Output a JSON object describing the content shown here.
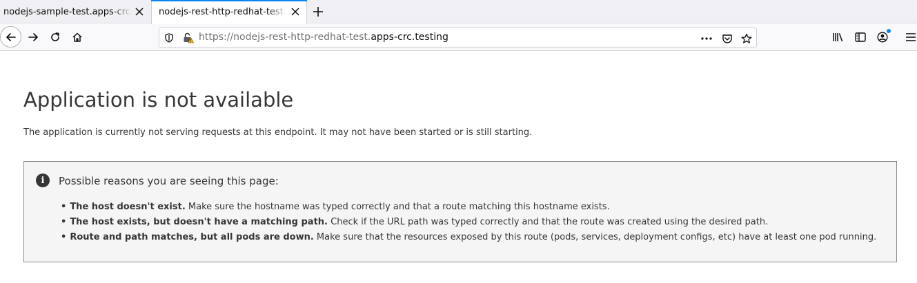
{
  "browser": {
    "tabs": [
      {
        "title": "nodejs-sample-test.apps-crc.testing",
        "active": false
      },
      {
        "title": "nodejs-rest-http-redhat-test.apps-crc.testing",
        "active": true
      }
    ],
    "url": {
      "prefix": "https://nodejs-rest-http-redhat-test.",
      "domain": "apps-crc.testing"
    },
    "icons": {
      "back": "back-arrow-icon",
      "forward": "forward-arrow-icon",
      "reload": "reload-icon",
      "home": "home-icon",
      "shield": "tracking-shield-icon",
      "lock": "insecure-lock-icon",
      "more": "page-actions-icon",
      "pocket": "pocket-icon",
      "star": "bookmark-star-icon",
      "library": "library-icon",
      "sidebar": "sidebar-icon",
      "account": "account-icon",
      "menu": "hamburger-menu-icon"
    },
    "accent_color": "#0a84ff"
  },
  "page": {
    "heading": "Application is not available",
    "description": "The application is currently not serving requests at this endpoint. It may not have been started or is still starting.",
    "reasons": {
      "title": "Possible reasons you are seeing this page:",
      "items": [
        {
          "strong": "The host doesn't exist.",
          "text": " Make sure the hostname was typed correctly and that a route matching this hostname exists."
        },
        {
          "strong": "The host exists, but doesn't have a matching path.",
          "text": " Check if the URL path was typed correctly and that the route was created using the desired path."
        },
        {
          "strong": "Route and path matches, but all pods are down.",
          "text": " Make sure that the resources exposed by this route (pods, services, deployment configs, etc) have at least one pod running."
        }
      ]
    }
  }
}
